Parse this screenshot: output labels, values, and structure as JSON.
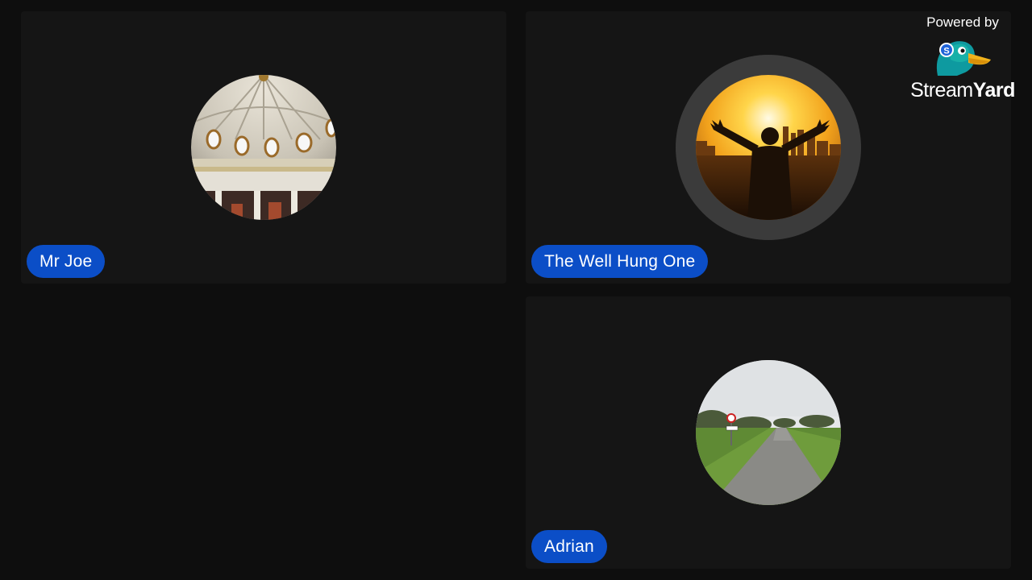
{
  "branding": {
    "powered_by": "Powered by",
    "wordmark_light": "Stream",
    "wordmark_bold": "Yard",
    "logo_icon": "duck-mascot-icon"
  },
  "participants": [
    {
      "name": "Mr Joe",
      "avatar": "dome-interior-photo",
      "speaking": false
    },
    {
      "name": "The Well Hung One",
      "avatar": "sunset-silhouette-photo",
      "speaking": true
    },
    {
      "name": "Adrian",
      "avatar": "country-road-photo",
      "speaking": false
    }
  ],
  "colors": {
    "background": "#0e0e0e",
    "tile": "#151515",
    "name_tag": "#0b4ec7",
    "speaking_ring": "#3b3b3b"
  }
}
